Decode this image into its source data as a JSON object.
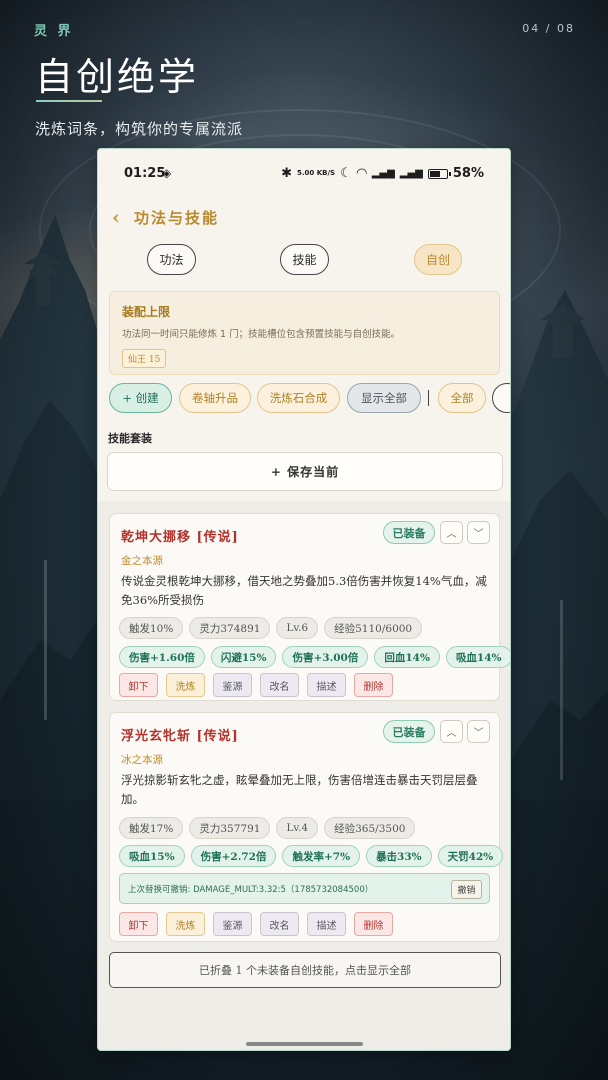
{
  "header": {
    "brand": "灵 界",
    "pager": "04 / 08",
    "title": "自创绝学",
    "subtitle": "洗炼词条，构筑你的专属流派"
  },
  "status_bar": {
    "time": "01:25",
    "speed": "5.00 KB/S",
    "battery": "58%"
  },
  "nav": {
    "back_icon": "chevron-left-icon",
    "title": "功法与技能"
  },
  "tabs": [
    {
      "label": "功法",
      "active": false
    },
    {
      "label": "技能",
      "active": false
    },
    {
      "label": "自创",
      "active": true
    }
  ],
  "notice": {
    "title": "装配上限",
    "text": "功法同一时间只能修炼 1 门；技能槽位包含预置技能与自创技能。",
    "badge": "仙王 15"
  },
  "actions": {
    "create": "+ 创建",
    "scroll_upgrade": "卷轴升品",
    "stone_merge": "洗炼石合成",
    "show_all": "显示全部",
    "filter_all": "全部"
  },
  "loadout": {
    "label": "技能套装",
    "save_button": "+ 保存当前"
  },
  "skills": [
    {
      "name": "乾坤大挪移 [传说]",
      "equipped_label": "已装备",
      "source": "金之本源",
      "description": "传说金灵根乾坤大挪移，借天地之势叠加5.3倍伤害并恢复14%气血，减免36%所受损伤",
      "stats": [
        "触发10%",
        "灵力374891",
        "Lv.6",
        "经验5110/6000"
      ],
      "buffs": [
        "伤害+1.60倍",
        "闪避15%",
        "伤害+3.00倍",
        "回血14%",
        "吸血14%"
      ]
    },
    {
      "name": "浮光玄牝斩 [传说]",
      "equipped_label": "已装备",
      "source": "冰之本源",
      "description": "浮光掠影斩玄牝之虚，眩晕叠加无上限，伤害倍增连击暴击天罚层层叠加。",
      "stats": [
        "触发17%",
        "灵力357791",
        "Lv.4",
        "经验365/3500"
      ],
      "buffs": [
        "吸血15%",
        "伤害+2.72倍",
        "触发率+7%",
        "暴击33%",
        "天罚42%"
      ],
      "undo": {
        "text": "上次替换可撤销: DAMAGE_MULT:3.32:5（1785732084500）",
        "button": "撤销"
      }
    }
  ],
  "skill_ops": {
    "unequip": "卸下",
    "refine": "洗炼",
    "appraise": "鉴源",
    "rename": "改名",
    "describe": "描述",
    "delete": "删除"
  },
  "folded_notice": "已折叠 1 个未装备自创技能，点击显示全部",
  "colors": {
    "accent_gold": "#b88a2e",
    "legend_red": "#b3322c",
    "jade_green": "#2b7d62"
  }
}
